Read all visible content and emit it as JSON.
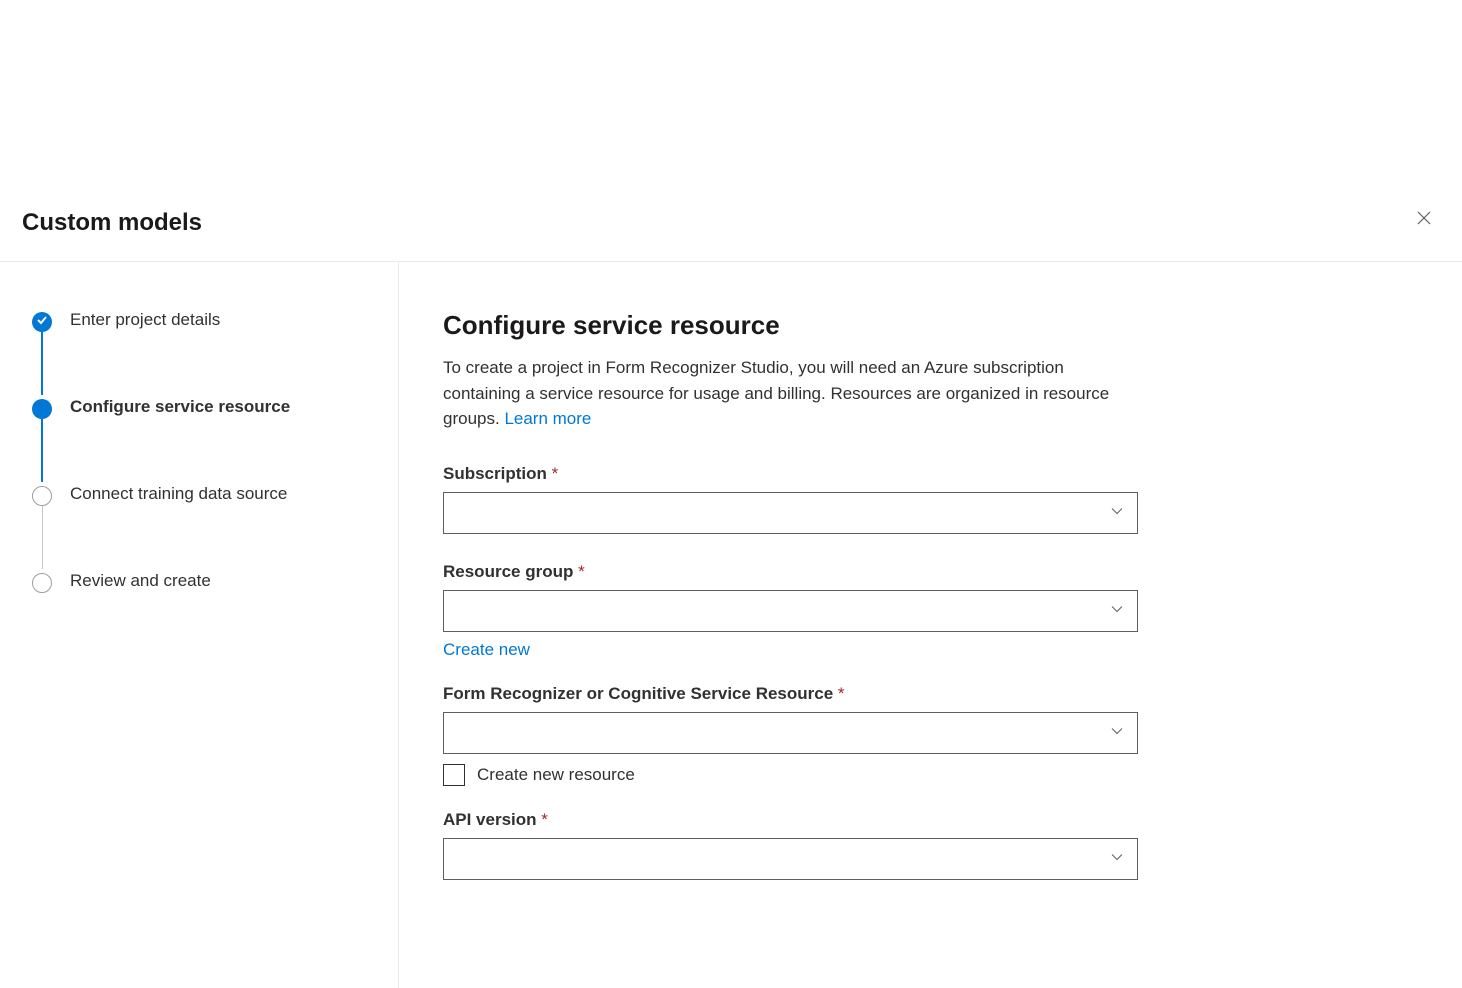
{
  "header": {
    "title": "Custom models"
  },
  "steps": [
    {
      "label": "Enter project details",
      "state": "completed"
    },
    {
      "label": "Configure service resource",
      "state": "active"
    },
    {
      "label": "Connect training data source",
      "state": "upcoming"
    },
    {
      "label": "Review and create",
      "state": "upcoming"
    }
  ],
  "main": {
    "title": "Configure service resource",
    "description": "To create a project in Form Recognizer Studio, you will need an Azure subscription containing a service resource for usage and billing. Resources are organized in resource groups. ",
    "learn_more": "Learn more",
    "fields": {
      "subscription": {
        "label": "Subscription",
        "required": true,
        "value": ""
      },
      "resource_group": {
        "label": "Resource group",
        "required": true,
        "value": "",
        "create_new": "Create new"
      },
      "service_resource": {
        "label": "Form Recognizer or Cognitive Service Resource",
        "required": true,
        "value": "",
        "create_new_checkbox": "Create new resource"
      },
      "api_version": {
        "label": "API version",
        "required": true,
        "value": ""
      }
    }
  }
}
